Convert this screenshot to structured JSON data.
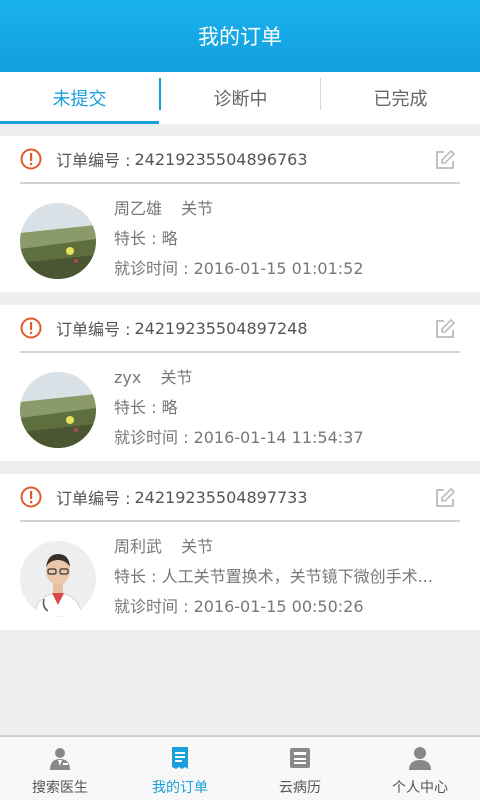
{
  "header": {
    "title": "我的订单"
  },
  "tabs": [
    {
      "label": "未提交",
      "active": true
    },
    {
      "label": "诊断中",
      "active": false
    },
    {
      "label": "已完成",
      "active": false
    }
  ],
  "orders": [
    {
      "order_label": "订单编号 :",
      "order_no": "24219235504896763",
      "doctor": "周乙雄",
      "dept": "关节",
      "specialty": "特长 : 略",
      "visit_time": "就诊时间 : 2016-01-15 01:01:52",
      "avatar": "landscape-photo"
    },
    {
      "order_label": "订单编号 :",
      "order_no": "24219235504897248",
      "doctor": "zyx",
      "dept": "关节",
      "specialty": "特长 : 略",
      "visit_time": "就诊时间 : 2016-01-14 11:54:37",
      "avatar": "landscape-photo"
    },
    {
      "order_label": "订单编号 :",
      "order_no": "24219235504897733",
      "doctor": "周利武",
      "dept": "关节",
      "specialty": "特长 : 人工关节置换术，关节镜下微创手术...",
      "visit_time": "就诊时间 : 2016-01-15 00:50:26",
      "avatar": "doctor-photo"
    }
  ],
  "bottom_nav": [
    {
      "label": "搜索医生",
      "icon": "doctor-search-icon",
      "active": false
    },
    {
      "label": "我的订单",
      "icon": "order-icon",
      "active": true
    },
    {
      "label": "云病历",
      "icon": "medical-record-icon",
      "active": false
    },
    {
      "label": "个人中心",
      "icon": "person-icon",
      "active": false
    }
  ],
  "colors": {
    "accent": "#1a9fdc",
    "alert": "#e25a2b"
  }
}
